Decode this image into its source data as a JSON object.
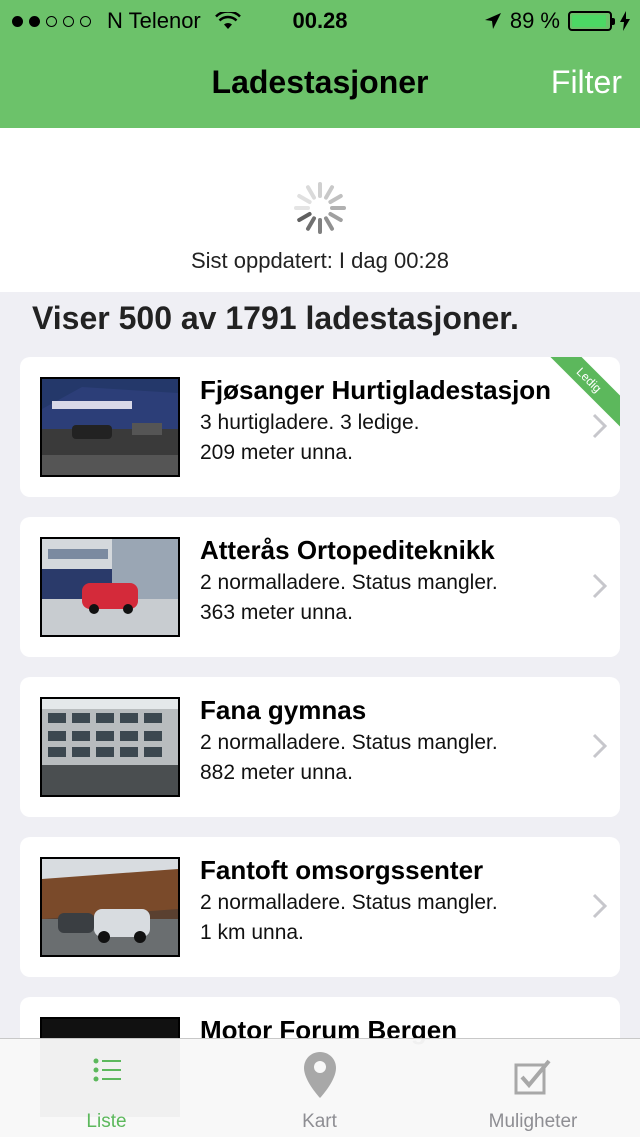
{
  "status": {
    "carrier": "N Telenor",
    "time": "00.28",
    "battery": "89 %",
    "signal_full": 2,
    "signal_total": 5
  },
  "nav": {
    "title": "Ladestasjoner",
    "filter_label": "Filter"
  },
  "refresh": {
    "last_updated": "Sist oppdatert: I dag 00:28"
  },
  "summary": "Viser 500 av 1791 ladestasjoner.",
  "stations": [
    {
      "name": "Fjøsanger Hurtigladestasjon",
      "detail": "3 hurtigladere. 3 ledige.",
      "distance": "209 meter unna.",
      "badge": "Ledig"
    },
    {
      "name": "Atterås Ortopediteknikk",
      "detail": "2 normalladere. Status mangler.",
      "distance": "363 meter unna."
    },
    {
      "name": "Fana gymnas",
      "detail": "2 normalladere. Status mangler.",
      "distance": "882 meter unna."
    },
    {
      "name": "Fantoft omsorgssenter",
      "detail": "2 normalladere. Status mangler.",
      "distance": "1 km unna."
    },
    {
      "name": "Motor Forum Bergen"
    }
  ],
  "tabs": [
    {
      "label": "Liste",
      "icon": "list-icon"
    },
    {
      "label": "Kart",
      "icon": "map-pin-icon"
    },
    {
      "label": "Muligheter",
      "icon": "checkbox-icon"
    }
  ],
  "colors": {
    "accent": "#6cc26a",
    "active_tab": "#5cb85c"
  }
}
